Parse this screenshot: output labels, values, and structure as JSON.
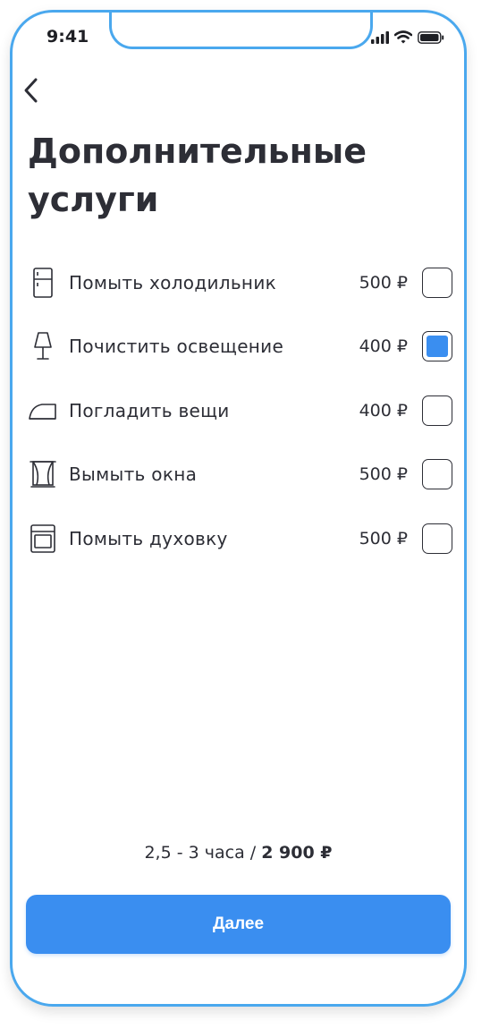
{
  "status_bar": {
    "time": "9:41"
  },
  "header": {
    "back_icon": "chevron-left-icon",
    "title_line1": "Дополнительные",
    "title_line2": "услуги"
  },
  "services": [
    {
      "icon": "fridge-icon",
      "label": "Помыть холодильник",
      "price": "500 ₽",
      "checked": false
    },
    {
      "icon": "lamp-icon",
      "label": "Почистить освещение",
      "price": "400 ₽",
      "checked": true
    },
    {
      "icon": "iron-icon",
      "label": "Погладить вещи",
      "price": "400 ₽",
      "checked": false
    },
    {
      "icon": "window-icon",
      "label": "Вымыть окна",
      "price": "500 ₽",
      "checked": false
    },
    {
      "icon": "oven-icon",
      "label": "Помыть духовку",
      "price": "500 ₽",
      "checked": false
    }
  ],
  "summary": {
    "duration": "2,5 - 3 часа / ",
    "total": "2 900 ₽"
  },
  "footer": {
    "next_label": "Далее"
  },
  "colors": {
    "accent": "#3a8ef0",
    "frame": "#4aa8ee",
    "text": "#2d2e36"
  }
}
